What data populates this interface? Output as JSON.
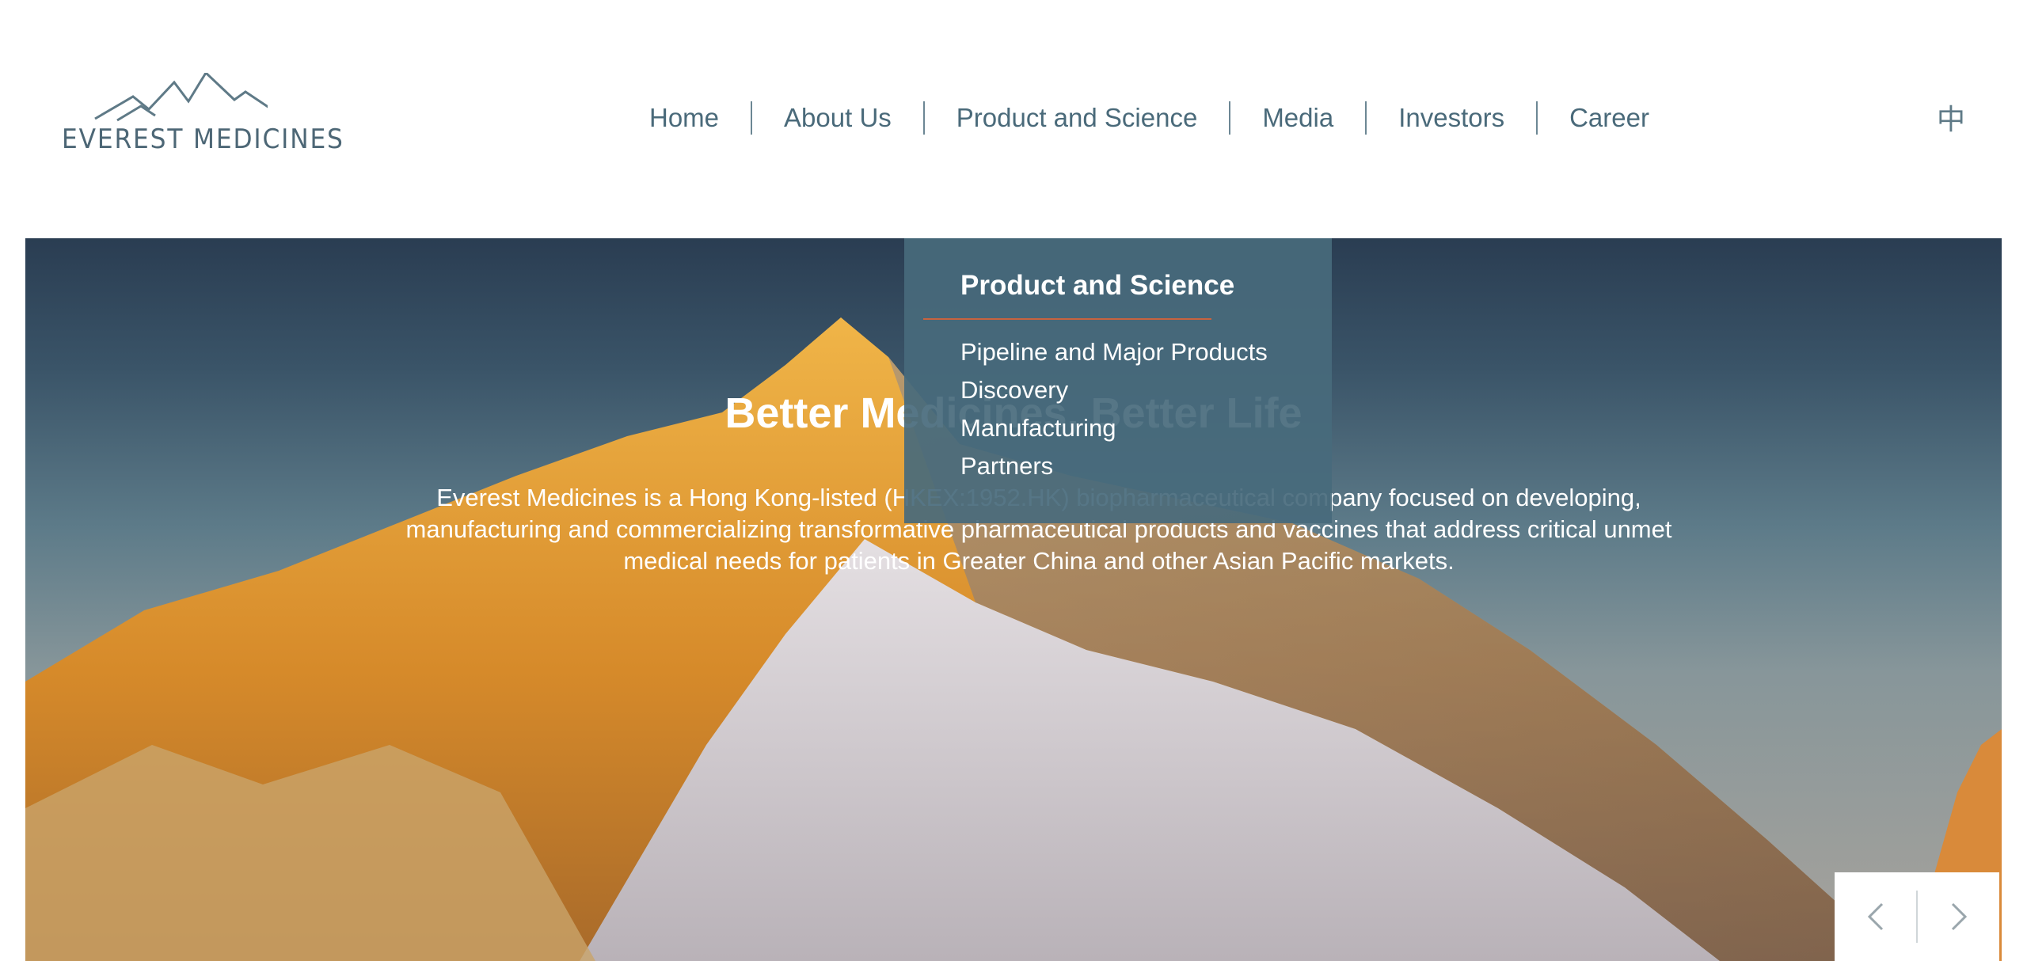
{
  "brand": {
    "name": "EVEREST MEDICINES",
    "logo_icon": "mountain-peaks-icon",
    "color": "#4d6776"
  },
  "nav": {
    "items": [
      {
        "label": "Home"
      },
      {
        "label": "About Us"
      },
      {
        "label": "Product and Science"
      },
      {
        "label": "Media"
      },
      {
        "label": "Investors"
      },
      {
        "label": "Career"
      }
    ],
    "color": "#4a6a7a"
  },
  "language_toggle": {
    "label": "中"
  },
  "dropdown": {
    "title": "Product and Science",
    "items": [
      {
        "label": "Pipeline and Major Products"
      },
      {
        "label": "Discovery"
      },
      {
        "label": "Manufacturing"
      },
      {
        "label": "Partners"
      }
    ],
    "background": "#486a7c",
    "accent": "#c8633f"
  },
  "hero": {
    "title": "Better Medicines, Better Life",
    "description": "Everest Medicines is a Hong Kong-listed (HKEX:1952.HK) biopharmaceutical company focused on developing, manufacturing and commercializing transformative pharmaceutical products and vaccines that address critical unmet medical needs for patients in Greater China and other Asian Pacific markets."
  },
  "slider": {
    "prev_icon": "chevron-left-icon",
    "next_icon": "chevron-right-icon"
  }
}
